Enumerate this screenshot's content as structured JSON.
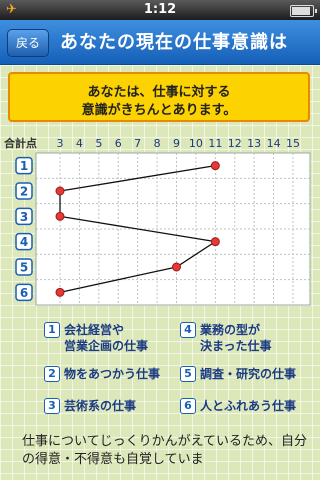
{
  "status": {
    "time": "1:12",
    "battery_level": 0.9
  },
  "nav": {
    "back_label": "戻る",
    "title": "あなたの現在の仕事意識は"
  },
  "banner": {
    "line1": "あなたは、仕事に対する",
    "line2": "意識がきちんとあります。"
  },
  "chart_data": {
    "type": "line",
    "xlabel": "合計点",
    "x_ticks": [
      "3",
      "4",
      "5",
      "6",
      "7",
      "8",
      "9",
      "10",
      "11",
      "12",
      "13",
      "14",
      "15"
    ],
    "xlim": [
      3,
      15
    ],
    "categories": [
      "1",
      "2",
      "3",
      "4",
      "5",
      "6"
    ],
    "values": [
      11,
      3,
      3,
      11,
      9,
      3
    ],
    "line_color": "#111111",
    "point_color": "#e53935"
  },
  "legend": [
    {
      "num": "1",
      "text": "会社経営や\n営業企画の仕事"
    },
    {
      "num": "4",
      "text": "業務の型が\n決まった仕事"
    },
    {
      "num": "2",
      "text": "物をあつかう仕事"
    },
    {
      "num": "5",
      "text": "調査・研究の仕事"
    },
    {
      "num": "3",
      "text": "芸術系の仕事"
    },
    {
      "num": "6",
      "text": "人とふれあう仕事"
    }
  ],
  "paragraph": "仕事についてじっくりかんがえているため、自分の得意・不得意も自覚していま"
}
